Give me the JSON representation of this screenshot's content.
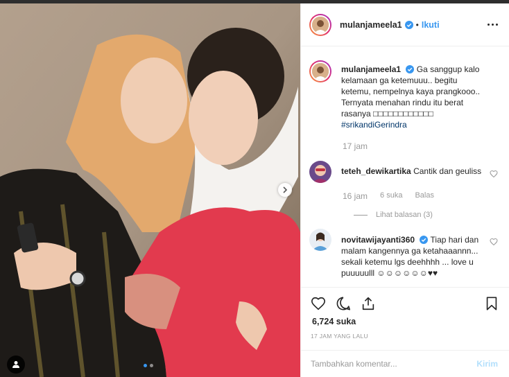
{
  "post": {
    "username": "mulanjameela1",
    "follow_label": "Ikuti",
    "separator": "•"
  },
  "caption": {
    "username": "mulanjameela1",
    "text": "Ga sanggup kalo kelamaan ga ketemuuu.. begitu ketemu, nempelnya kaya prangkooo.. Ternyata menahan rindu itu berat rasanya",
    "emojis": "□□□□□□□□□□□□",
    "hashtag": "#srikandiGerindra",
    "time": "17 jam"
  },
  "comments": [
    {
      "username": "teteh_dewikartika",
      "text": "Cantik dan geuliss",
      "time": "16 jam",
      "likes": "6 suka",
      "reply_label": "Balas",
      "view_replies": "Lihat balasan (3)"
    },
    {
      "username": "novitawijayanti360",
      "text": "Tiap hari dan malam kangennya ga ketahaaannn... sekali ketemu lgs deehhhh ... love u puuuuulll",
      "emojis": "☺☺☺☺☺☺♥♥"
    }
  ],
  "actions": {
    "likes": "6,724 suka",
    "time": "17 JAM YANG LALU"
  },
  "add_comment": {
    "placeholder": "Tambahkan komentar...",
    "post_label": "Kirim"
  },
  "icons": {
    "verified": "verified-badge-icon",
    "more": "more-options-icon",
    "like": "heart-icon",
    "comment": "comment-bubble-icon",
    "share": "share-icon",
    "save": "bookmark-icon",
    "next": "chevron-right-icon",
    "tag": "user-tag-icon"
  },
  "colors": {
    "accent": "#3897f0",
    "hashtag": "#003569",
    "muted": "#999999",
    "border": "#efefef"
  }
}
